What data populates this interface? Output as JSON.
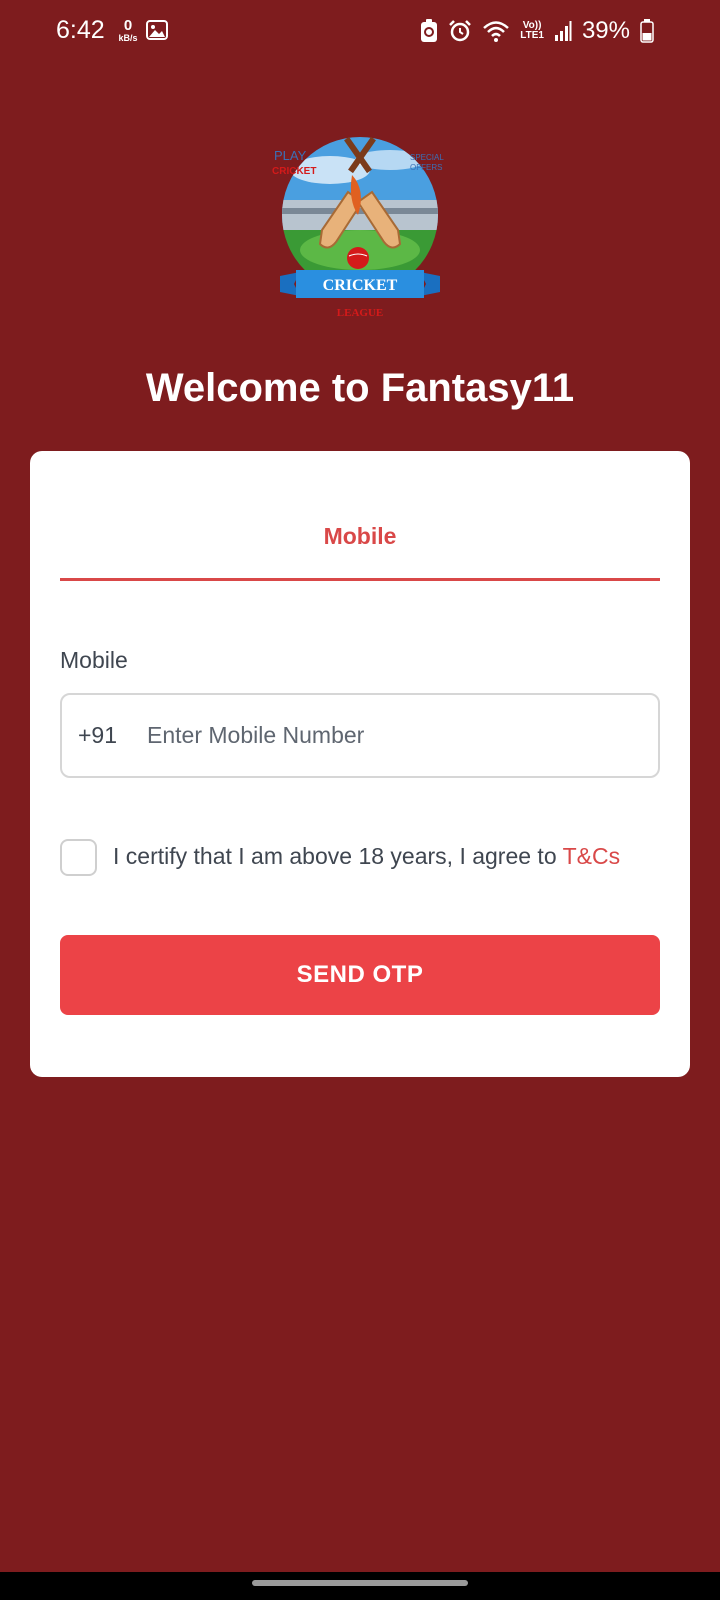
{
  "status_bar": {
    "time": "6:42",
    "net_speed_value": "0",
    "net_speed_unit": "kB/s",
    "volte_line1": "Vo))",
    "volte_line2": "LTE1",
    "battery_percent": "39%",
    "icons": [
      "gallery-icon",
      "screen-record-icon",
      "alarm-icon",
      "wifi-icon",
      "signal-icon",
      "battery-icon"
    ]
  },
  "logo": {
    "top_left_line1": "PLAY",
    "top_left_line2": "CRICKET",
    "top_right_line1": "SPECIAL",
    "top_right_line2": "OFFERS",
    "banner": "CRICKET",
    "banner_sub": "LEAGUE"
  },
  "welcome": {
    "title": "Welcome to Fantasy11"
  },
  "login_card": {
    "tab_label": "Mobile",
    "mobile_label": "Mobile",
    "country_code": "+91",
    "mobile_placeholder": "Enter Mobile Number",
    "mobile_value": "",
    "certify_text": "I certify that I am above 18 years, I agree to ",
    "tc_link": "T&Cs",
    "send_otp_label": "SEND OTP"
  },
  "colors": {
    "background": "#7e1c1e",
    "accent": "#d94848",
    "button": "#ec4347",
    "card": "#ffffff"
  }
}
